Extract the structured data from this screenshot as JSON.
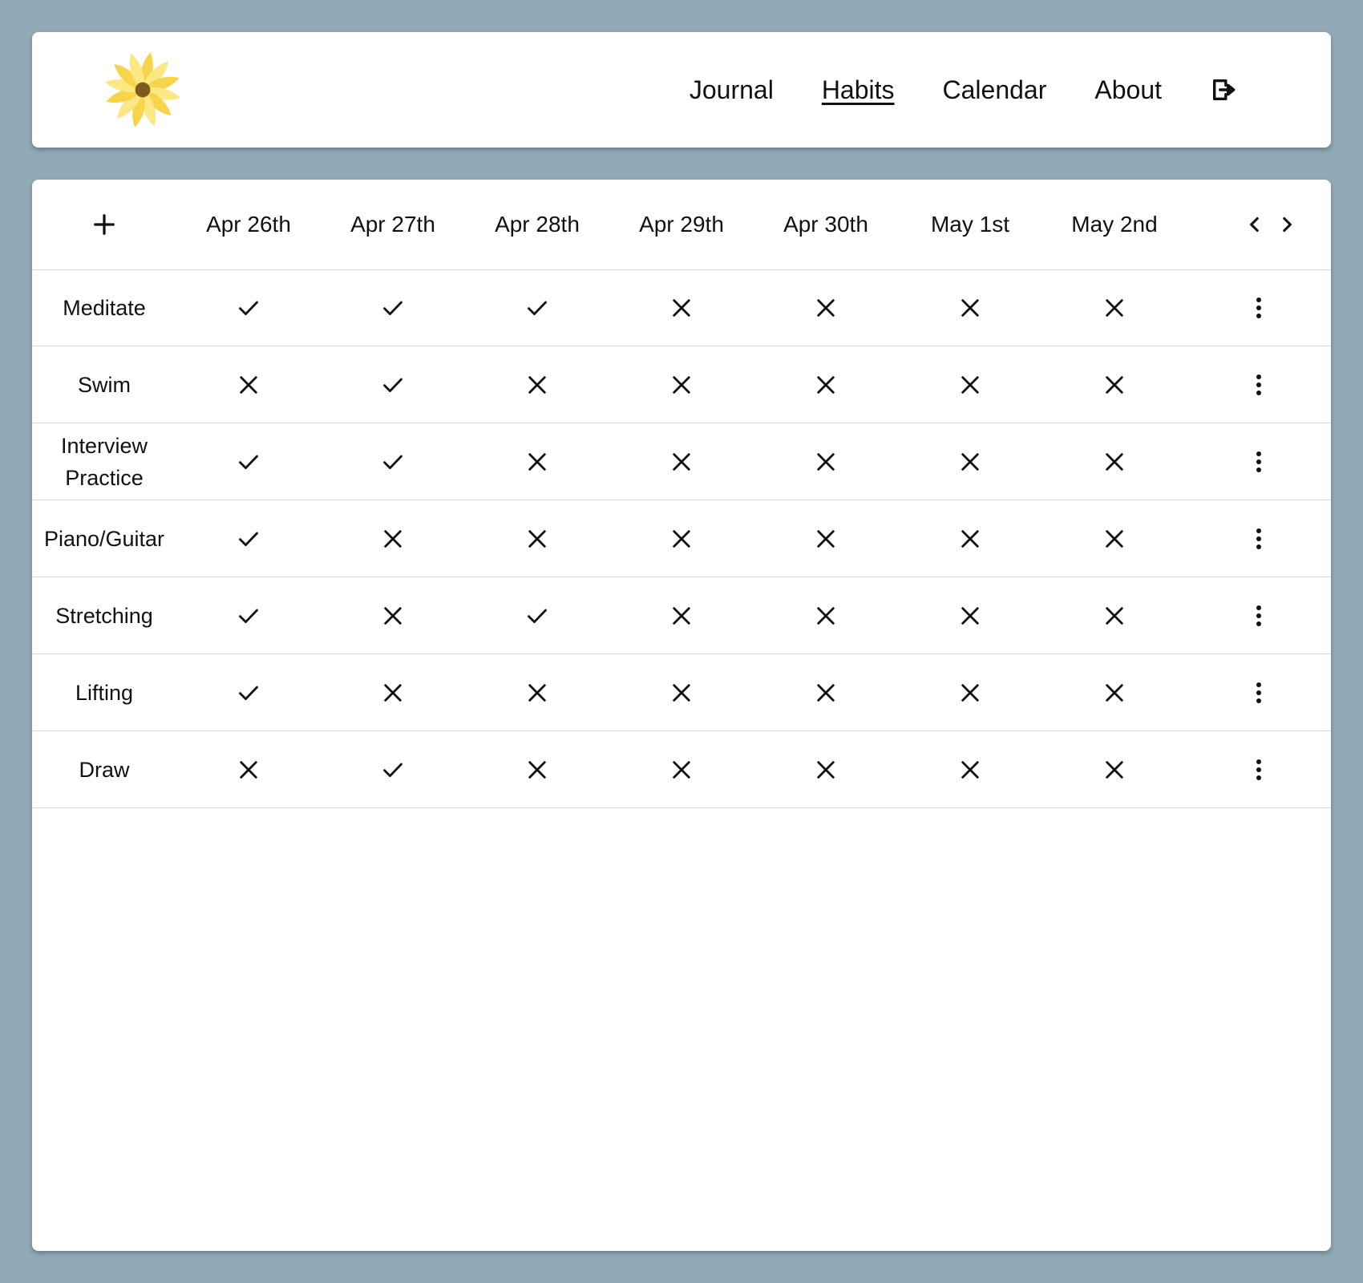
{
  "nav": {
    "logo_icon": "sunflower-icon",
    "links": [
      {
        "label": "Journal",
        "active": false
      },
      {
        "label": "Habits",
        "active": true
      },
      {
        "label": "Calendar",
        "active": false
      },
      {
        "label": "About",
        "active": false
      }
    ],
    "logout_icon": "logout-icon"
  },
  "table": {
    "add_icon": "plus-icon",
    "prev_icon": "chevron-left-icon",
    "next_icon": "chevron-right-icon",
    "menu_icon": "more-vertical-icon",
    "dates": [
      "Apr 26th",
      "Apr 27th",
      "Apr 28th",
      "Apr 29th",
      "Apr 30th",
      "May 1st",
      "May 2nd"
    ],
    "habits": [
      {
        "name": "Meditate",
        "done": [
          true,
          true,
          true,
          false,
          false,
          false,
          false
        ]
      },
      {
        "name": "Swim",
        "done": [
          false,
          true,
          false,
          false,
          false,
          false,
          false
        ]
      },
      {
        "name": "Interview Practice",
        "done": [
          true,
          true,
          false,
          false,
          false,
          false,
          false
        ]
      },
      {
        "name": "Piano/Guitar",
        "done": [
          true,
          false,
          false,
          false,
          false,
          false,
          false
        ]
      },
      {
        "name": "Stretching",
        "done": [
          true,
          false,
          true,
          false,
          false,
          false,
          false
        ]
      },
      {
        "name": "Lifting",
        "done": [
          true,
          false,
          false,
          false,
          false,
          false,
          false
        ]
      },
      {
        "name": "Draw",
        "done": [
          false,
          true,
          false,
          false,
          false,
          false,
          false
        ]
      }
    ]
  },
  "colors": {
    "background": "#91a9b5",
    "card": "#ffffff",
    "petal": "#f7d54a",
    "petal_light": "#fbe783",
    "flower_center": "#7a5a1e"
  }
}
